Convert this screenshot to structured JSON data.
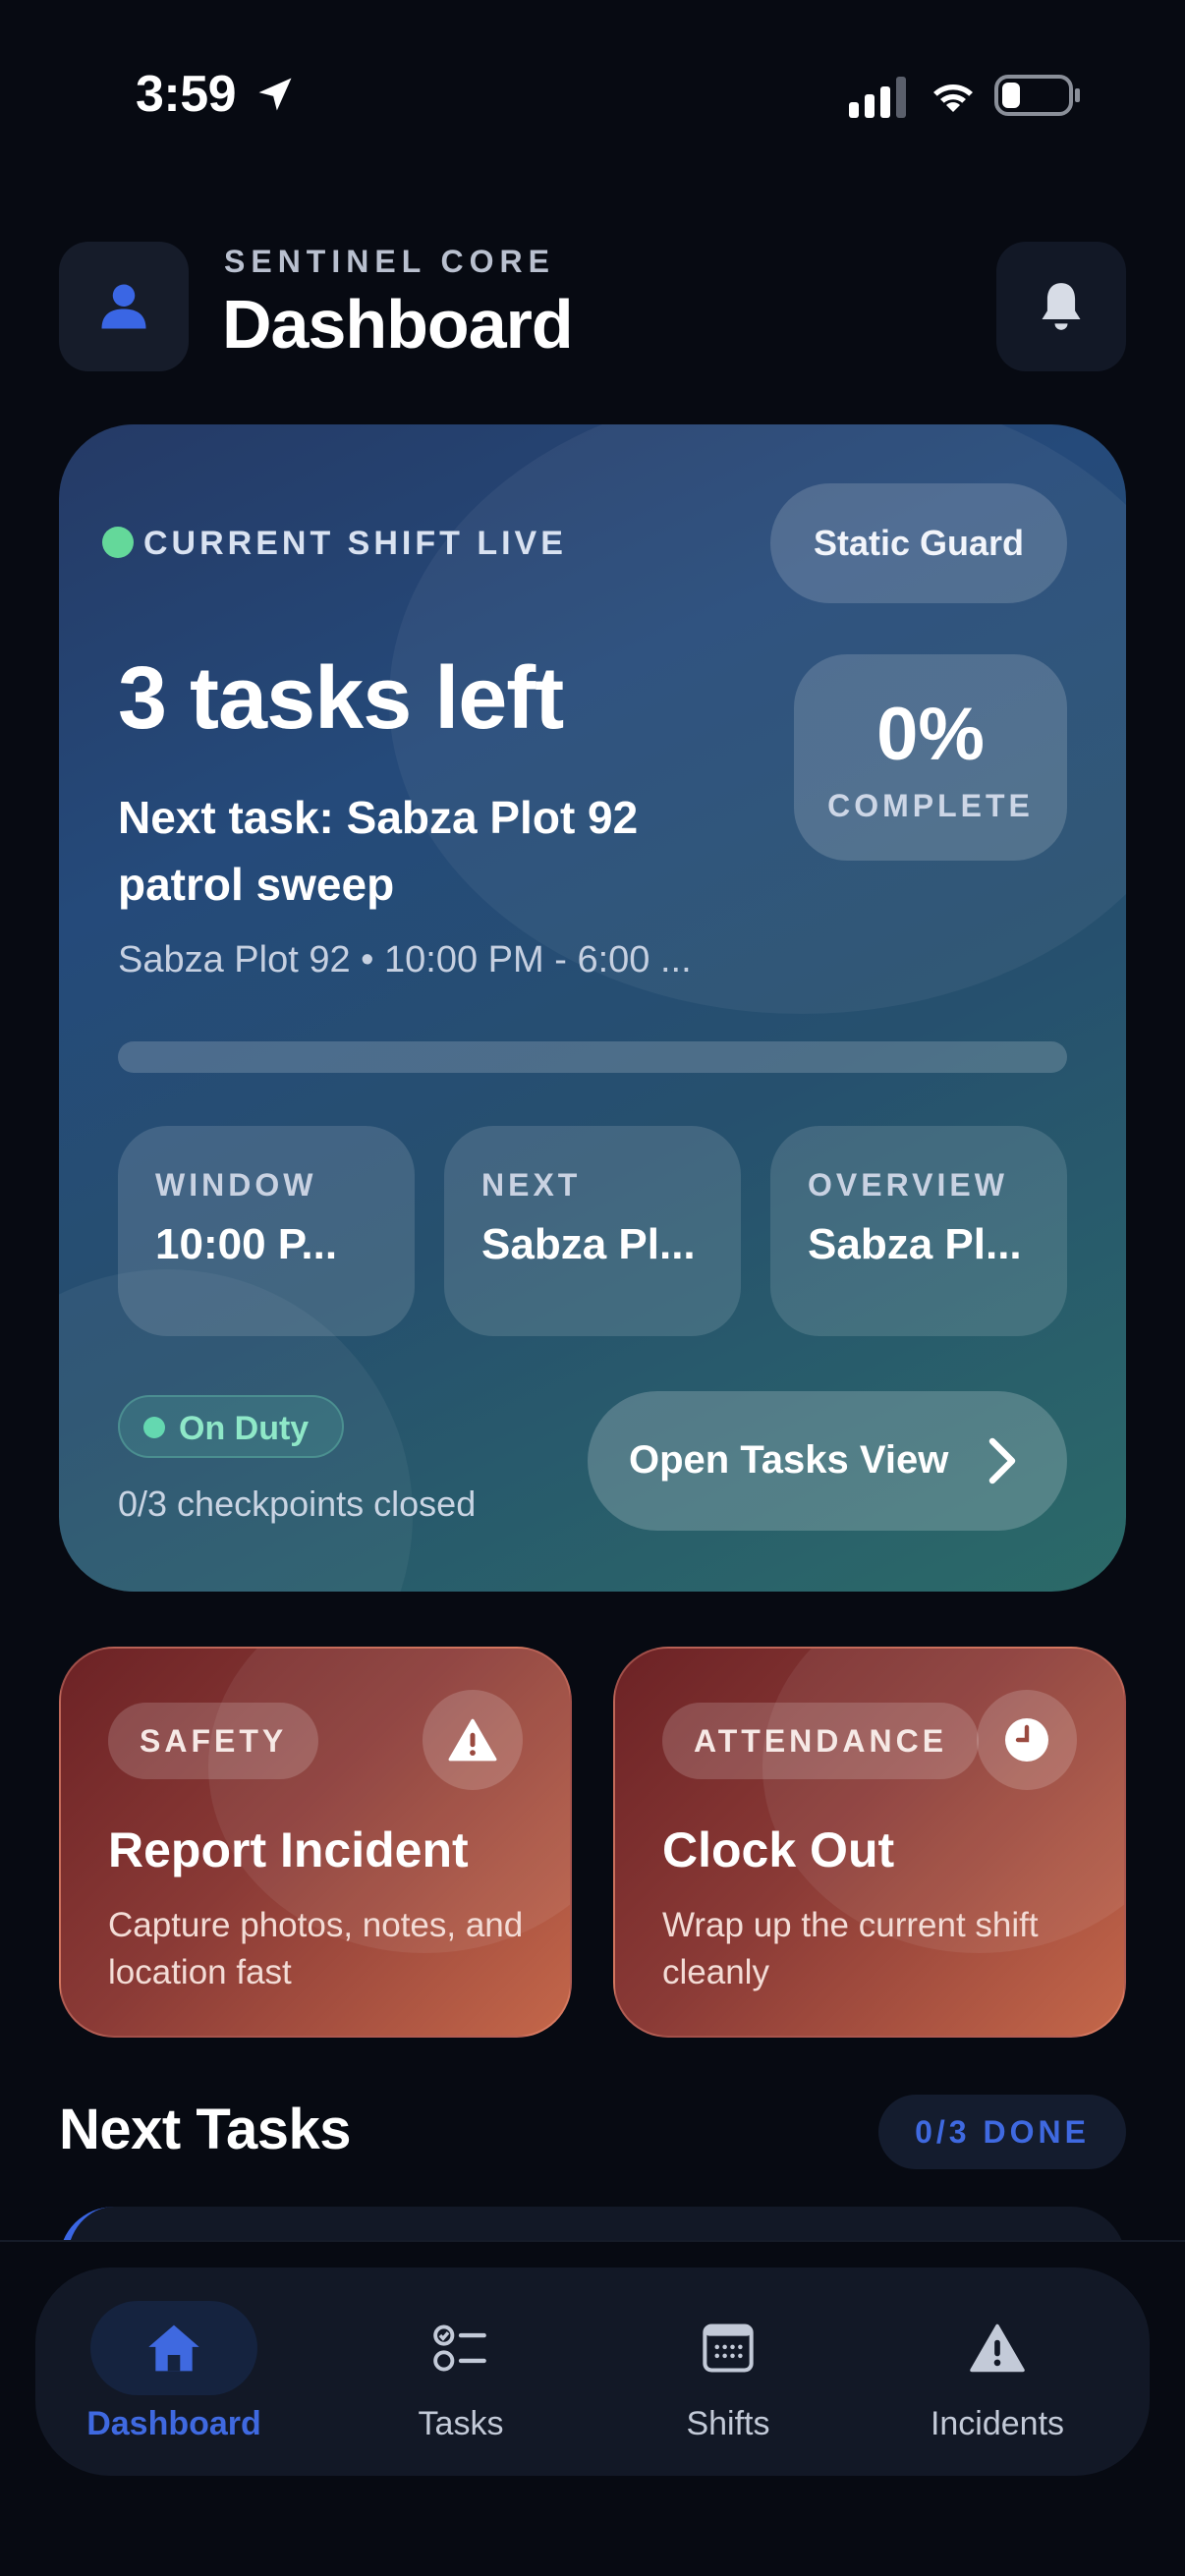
{
  "status_bar": {
    "time": "3:59",
    "icons": [
      "location-arrow-icon",
      "cellular-signal-icon",
      "wifi-icon",
      "battery-icon"
    ]
  },
  "header": {
    "brand": "SENTINEL CORE",
    "title": "Dashboard",
    "avatar_icon": "person-icon",
    "notifications_icon": "bell-icon"
  },
  "shift_card": {
    "live_label": "CURRENT SHIFT LIVE",
    "role": "Static Guard",
    "tasks_left": "3 tasks left",
    "next_task": "Next task: Sabza Plot 92 patrol sweep",
    "meta": "Sabza Plot 92 • 10:00 PM - 6:00 ...",
    "completion_value": "0%",
    "completion_label": "COMPLETE",
    "progress_fraction": 0,
    "stats": [
      {
        "label": "WINDOW",
        "value": "10:00 P..."
      },
      {
        "label": "NEXT",
        "value": "Sabza Pl..."
      },
      {
        "label": "OVERVIEW",
        "value": "Sabza Pl..."
      }
    ],
    "duty_status": "On Duty",
    "checkpoints": "0/3 checkpoints closed",
    "open_tasks_label": "Open Tasks View"
  },
  "actions": [
    {
      "chip": "SAFETY",
      "icon": "warning-icon",
      "title": "Report Incident",
      "description": "Capture photos, notes, and location fast"
    },
    {
      "chip": "ATTENDANCE",
      "icon": "clock-icon",
      "title": "Clock Out",
      "description": "Wrap up the current shift cleanly"
    }
  ],
  "next_tasks": {
    "title": "Next Tasks",
    "done_badge": "0/3 DONE"
  },
  "tab_bar": {
    "tabs": [
      {
        "label": "Dashboard",
        "icon": "home-icon",
        "active": true
      },
      {
        "label": "Tasks",
        "icon": "checklist-icon",
        "active": false
      },
      {
        "label": "Shifts",
        "icon": "calendar-icon",
        "active": false
      },
      {
        "label": "Incidents",
        "icon": "warning-icon",
        "active": false
      }
    ]
  },
  "colors": {
    "background": "#070a12",
    "accent_blue": "#3f69e0",
    "live_green": "#64d89a",
    "action_red": "#8a3a36"
  }
}
